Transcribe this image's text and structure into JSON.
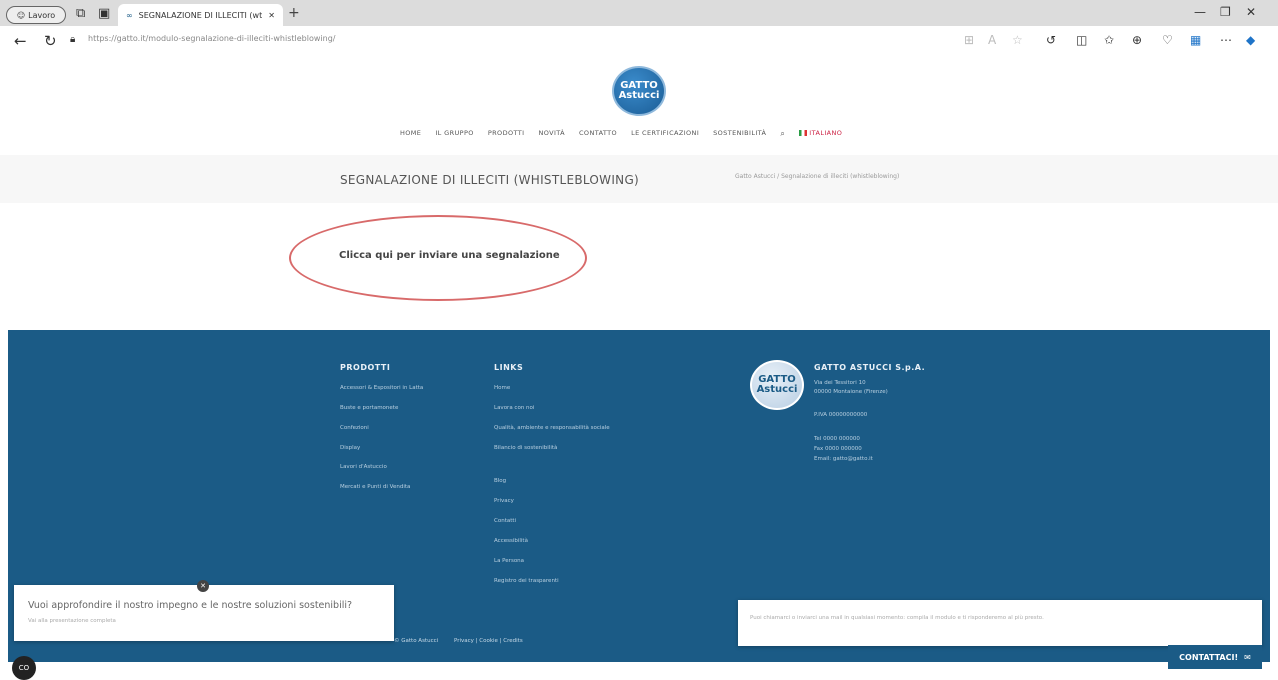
{
  "browser": {
    "profile_label": "Lavoro",
    "tab_title": "SEGNALAZIONE DI ILLECITI (wt",
    "url": "https://gatto.it/modulo-segnalazione-di-illeciti-whistleblowing/"
  },
  "site": {
    "logo_text": "GATTO Astucci",
    "nav": [
      "HOME",
      "IL GRUPPO",
      "PRODOTTI",
      "NOVITÀ",
      "CONTATTO",
      "LE CERTIFICAZIONI",
      "SOSTENIBILITÀ"
    ],
    "language": "ITALIANO"
  },
  "page": {
    "title": "SEGNALAZIONE DI ILLECITI (WHISTLEBLOWING)",
    "breadcrumb": "Gatto Astucci  /  Segnalazione di illeciti (whistleblowing)",
    "report_link": "Clicca qui per inviare una segnalazione"
  },
  "footer": {
    "products_heading": "PRODOTTI",
    "products": [
      "Accessori & Espositori in Latta",
      "Buste e portamonete",
      "Confezioni",
      "Display",
      "Lavori d'Astuccio",
      "Mercati e Punti di Vendita"
    ],
    "links_heading": "LINKS",
    "links": [
      "Home",
      "Lavora con noi",
      "Qualità, ambiente e responsabilità sociale",
      "Bilancio di sostenibilità",
      "Blog",
      "Privacy",
      "Contatti",
      "Accessibilità",
      "La Persona",
      "Registro dei trasparenti"
    ],
    "company_name": "GATTO ASTUCCI S.p.A.",
    "address_lines": [
      "Via dei Tessitori 10",
      "00000 Montaione (Firenze)"
    ],
    "vat": "P.IVA 00000000000",
    "phone": "Tel 0000 000000",
    "fax": "Fax 0000 000000",
    "email": "Email: gatto@gatto.it",
    "copyright": "© Gatto Astucci",
    "legal_links": "Privacy  |  Cookie  |  Credits"
  },
  "popups": {
    "left_line1": "Vuoi approfondire il nostro impegno e le nostre soluzioni sostenibili?",
    "left_line2": "Vai alla presentazione completa",
    "right_text": "Puoi chiamarci o inviarci una mail in qualsiasi momento: compila il modulo e ti risponderemo al più presto.",
    "contact_label": "CONTATTACI!"
  },
  "cookie_badge": "CO"
}
